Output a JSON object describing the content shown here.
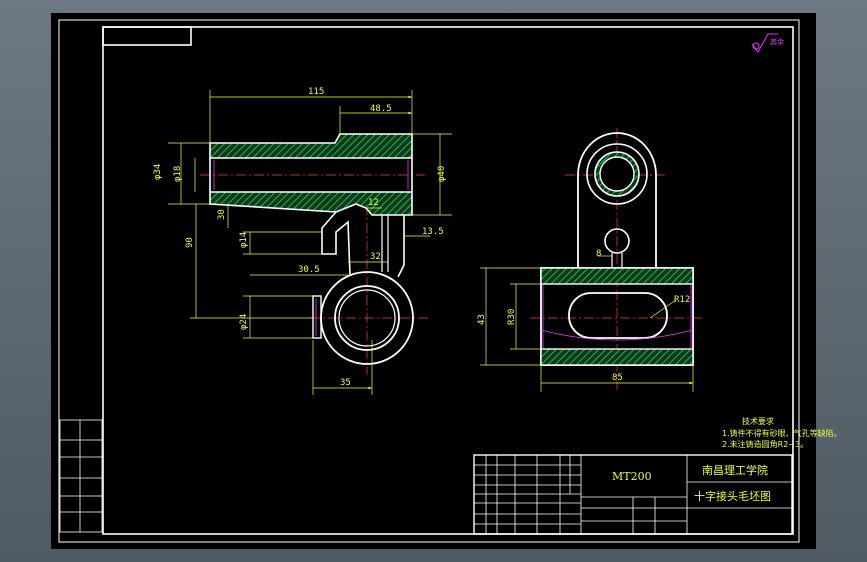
{
  "dimensions": {
    "d115": "115",
    "d48_5": "48.5",
    "d12": "12",
    "d13_5": "13.5",
    "d30_5": "30.5",
    "d32": "32",
    "d35": "35",
    "d8": "8",
    "d85": "85",
    "phi34": "φ34",
    "phi18": "φ18",
    "phi40": "φ40",
    "d30": "30",
    "d90": "90",
    "phi14": "φ14",
    "phi24": "φ24",
    "d43": "43",
    "r30": "R30",
    "r12": "R12"
  },
  "title_block": {
    "model": "MT200",
    "school": "南昌理工学院",
    "drawing_name": "十字接头毛坯图",
    "notes_title": "技术要求",
    "note_1": "1.铸件不得有砂眼、气孔等缺陷。",
    "note_2": "2.未注铸造圆角R2~3。"
  },
  "surface_symbol": "其余",
  "colors": {
    "background": "#000000",
    "outline": "#ffffff",
    "hatch": "#2ee36b",
    "dimension": "#eaff3a",
    "centerline": "#ff3b3b",
    "accent": "#e23bff"
  }
}
